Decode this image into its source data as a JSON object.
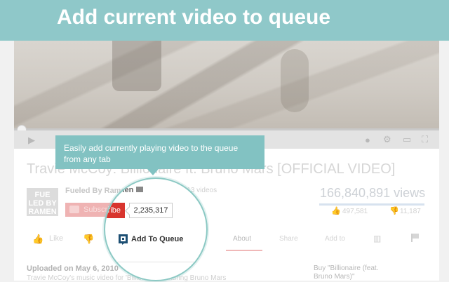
{
  "banner": {
    "title": "Add current video to queue"
  },
  "tooltip": {
    "text": "Easily add currently playing video to the queue from any tab"
  },
  "video": {
    "title": "Travie McCoy: Billionaire ft. Bruno Mars [OFFICIAL VIDEO]",
    "channel": "Fueled By Ramen",
    "channel_logo": "FUE LED BY RAMEN",
    "video_count": "· 1,113 videos",
    "subscribe_label": "Subscribe",
    "subscriber_count": "2,235,317",
    "views": "166,840,891 views",
    "likes": "497,581",
    "dislikes": "11,187"
  },
  "actions": {
    "like": "Like",
    "add_to_queue": "Add To Queue",
    "tabs": [
      "About",
      "Share",
      "Add to"
    ]
  },
  "description": {
    "uploaded": "Uploaded on May 6, 2010",
    "text": "Travie McCoy's music video for 'Billionaire' featuring Bruno Mars",
    "buy": "Buy \"Billionaire (feat. Bruno Mars)\""
  },
  "colors": {
    "banner": "#8fc8c9",
    "tooltip": "#82c2c2",
    "subscribe": "#d8352e",
    "magnifier_border": "#8cc9c4",
    "queue_icon": "#1d4f73"
  },
  "icons": {
    "play": "play-icon",
    "settings": "gear-icon",
    "fullscreen": "fullscreen-icon",
    "queue": "add-to-queue-icon"
  }
}
